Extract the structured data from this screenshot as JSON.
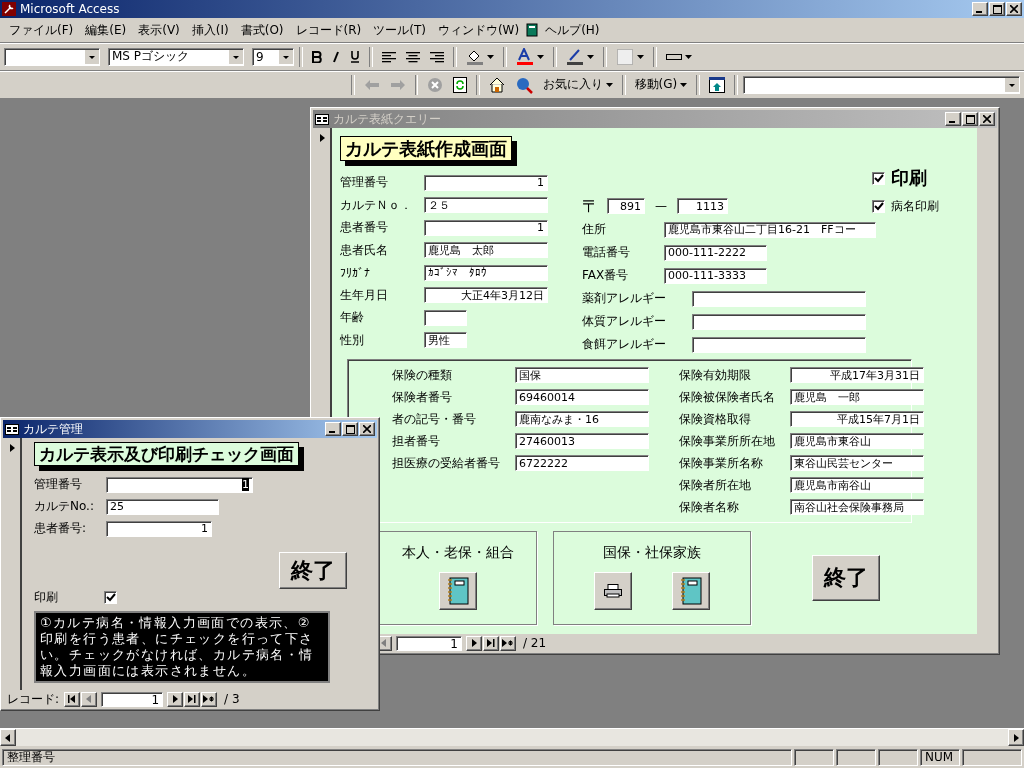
{
  "app": {
    "title": "Microsoft Access"
  },
  "menu": [
    {
      "kind": "menu",
      "label": "ファイル(F)"
    },
    {
      "kind": "menu",
      "label": "編集(E)"
    },
    {
      "kind": "menu",
      "label": "表示(V)"
    },
    {
      "kind": "menu",
      "label": "挿入(I)"
    },
    {
      "kind": "menu",
      "label": "書式(O)"
    },
    {
      "kind": "menu",
      "label": "レコード(R)"
    },
    {
      "kind": "menu",
      "label": "ツール(T)"
    },
    {
      "kind": "menu",
      "label": "ウィンドウ(W)"
    },
    {
      "kind": "icon"
    },
    {
      "kind": "menu",
      "label": "ヘルプ(H)"
    }
  ],
  "format_toolbar": {
    "font": "MS Pゴシック",
    "size": "9"
  },
  "web_toolbar": {
    "favorites": "お気に入り",
    "go": "移動(G)"
  },
  "cover_window": {
    "title": "カルテ表紙クエリー",
    "heading": "カルテ表紙作成画面",
    "patient_fields": [
      {
        "kind": "number",
        "label": "管理番号",
        "value": "1"
      },
      {
        "kind": "text",
        "label": "カルテＮｏ．",
        "value": "２５"
      },
      {
        "kind": "number",
        "label": "患者番号",
        "value": "1"
      },
      {
        "kind": "text",
        "label": "患者氏名",
        "value": "鹿児島　太郎"
      },
      {
        "kind": "text",
        "label": "ﾌﾘｶﾞﾅ",
        "value": "ｶｺﾞｼﾏ　ﾀﾛｳ"
      },
      {
        "kind": "number",
        "label": "生年月日",
        "value": "大正4年3月12日"
      },
      {
        "kind": "short",
        "label": "年齢"
      },
      {
        "kind": "short",
        "label": "性別",
        "value": "男性"
      }
    ],
    "zip": {
      "label": "〒",
      "first": "891",
      "separator": "—",
      "second": "1113"
    },
    "contact_fields": [
      {
        "kind": "wide",
        "label": "住所",
        "value": "鹿児島市東谷山二丁目16-21　FFコー"
      },
      {
        "kind": "medium",
        "label": "電話番号",
        "value": "000-111-2222"
      },
      {
        "kind": "medium",
        "label": "FAX番号",
        "value": "000-111-3333"
      },
      {
        "kind": "allergy",
        "label": "薬剤アレルギー"
      },
      {
        "kind": "allergy",
        "label": "体質アレルギー"
      },
      {
        "kind": "allergy",
        "label": "食餌アレルギー"
      }
    ],
    "print_options": [
      {
        "kind": "large",
        "label": "印刷",
        "checked": true
      },
      {
        "kind": "small",
        "label": "病名印刷",
        "checked": true
      }
    ],
    "insurance_left": [
      {
        "label": "保険の種類",
        "value": "国保"
      },
      {
        "label": "保険者番号",
        "value": "69460014"
      },
      {
        "label": "者の記号・番号",
        "value": "鹿南なみま・16"
      },
      {
        "label": "担者番号",
        "value": "27460013"
      },
      {
        "label": "担医療の受給者番号",
        "value": "6722222"
      }
    ],
    "insurance_right": [
      {
        "kind": "date",
        "label": "保険有効期限",
        "value": "平成17年3月31日"
      },
      {
        "kind": "text",
        "label": "保険被保険者氏名",
        "value": "鹿児島　一郎"
      },
      {
        "kind": "date",
        "label": "保険資格取得",
        "value": "平成15年7月1日"
      },
      {
        "kind": "text",
        "label": "保険事業所所在地",
        "value": "鹿児島市東谷山"
      },
      {
        "kind": "text",
        "label": "保険事業所名称",
        "value": "東谷山民芸センター"
      },
      {
        "kind": "text",
        "label": "保険者所在地",
        "value": "鹿児島市南谷山"
      },
      {
        "kind": "text",
        "label": "保険者名称",
        "value": "南谷山社会保険事務局"
      }
    ],
    "groups": [
      {
        "title": "本人・老保・組合",
        "buttons": [
          {
            "kind": "notebook"
          }
        ]
      },
      {
        "title": "国保・社保家族",
        "buttons": [
          {
            "kind": "printer"
          },
          {
            "kind": "notebook"
          }
        ]
      }
    ],
    "exit_button": "終了",
    "navigator": {
      "record": "1",
      "total": "/ 21"
    }
  },
  "karte_window": {
    "title": "カルテ管理",
    "heading": "カルテ表示及び印刷チェック画面",
    "fields": [
      {
        "kind": "active",
        "label": "管理番号",
        "value": "1"
      },
      {
        "kind": "text",
        "label": "カルテNo.:",
        "value": "25"
      },
      {
        "kind": "number",
        "label": "患者番号:",
        "value": "1"
      }
    ],
    "exit_button": "終了",
    "print": {
      "label": "印刷",
      "checked": true
    },
    "note": "①カルテ病名・情報入力画面での表示、②印刷を行う患者、にチェックを行って下さい。チェックがなければ、カルテ病名・情報入力画面には表示されません。",
    "navigator": {
      "label": "レコード:",
      "record": "1",
      "total": "/ 3"
    }
  },
  "status_bar": {
    "text": "整理番号",
    "indicator": "NUM"
  }
}
